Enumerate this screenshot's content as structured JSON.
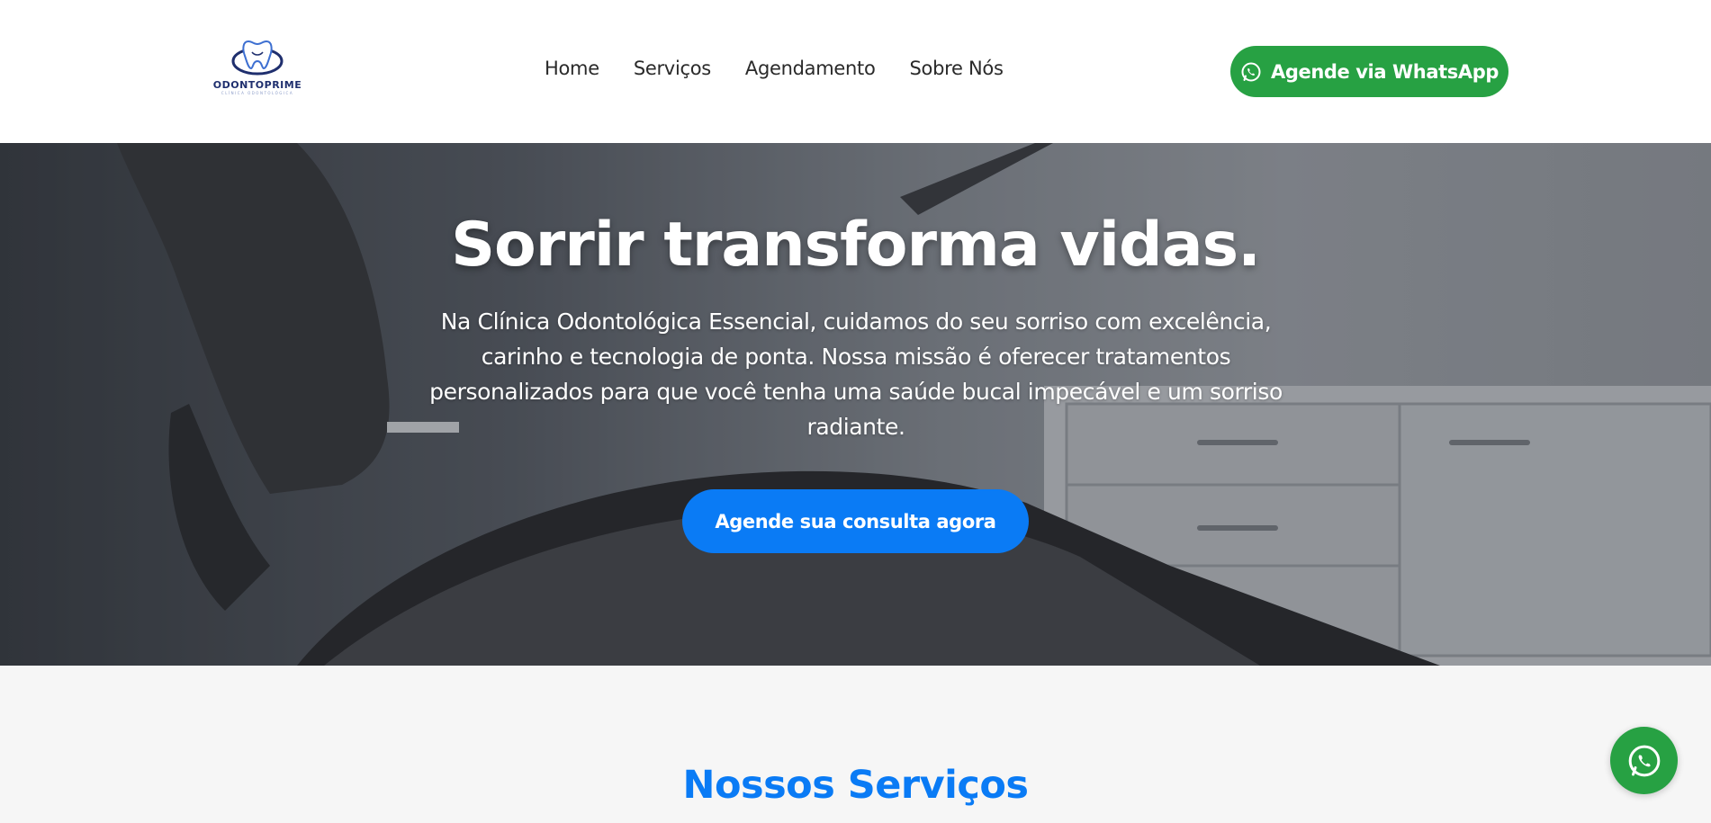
{
  "header": {
    "logo": {
      "name": "ODONTOPRIME",
      "subtitle": "CLÍNICA ODONTOLÓGICA"
    },
    "nav": [
      {
        "label": "Home"
      },
      {
        "label": "Serviços"
      },
      {
        "label": "Agendamento"
      },
      {
        "label": "Sobre Nós"
      }
    ],
    "whatsapp_button": {
      "label": "Agende via WhatsApp",
      "icon": "whatsapp-icon"
    }
  },
  "hero": {
    "title": "Sorrir transforma vidas.",
    "text": "Na Clínica Odontológica Essencial, cuidamos do seu sorriso com excelência, carinho e tecnologia de ponta. Nossa missão é oferecer tratamentos personalizados para que você tenha uma saúde bucal impecável e um sorriso radiante.",
    "cta_label": "Agende sua consulta agora"
  },
  "services": {
    "title": "Nossos Serviços"
  },
  "floating_whatsapp": {
    "icon": "whatsapp-icon"
  },
  "colors": {
    "green": "#27a143",
    "blue": "#0a7bf5",
    "text_dark": "#2a2a2a",
    "logo_navy": "#1f2f6e"
  }
}
